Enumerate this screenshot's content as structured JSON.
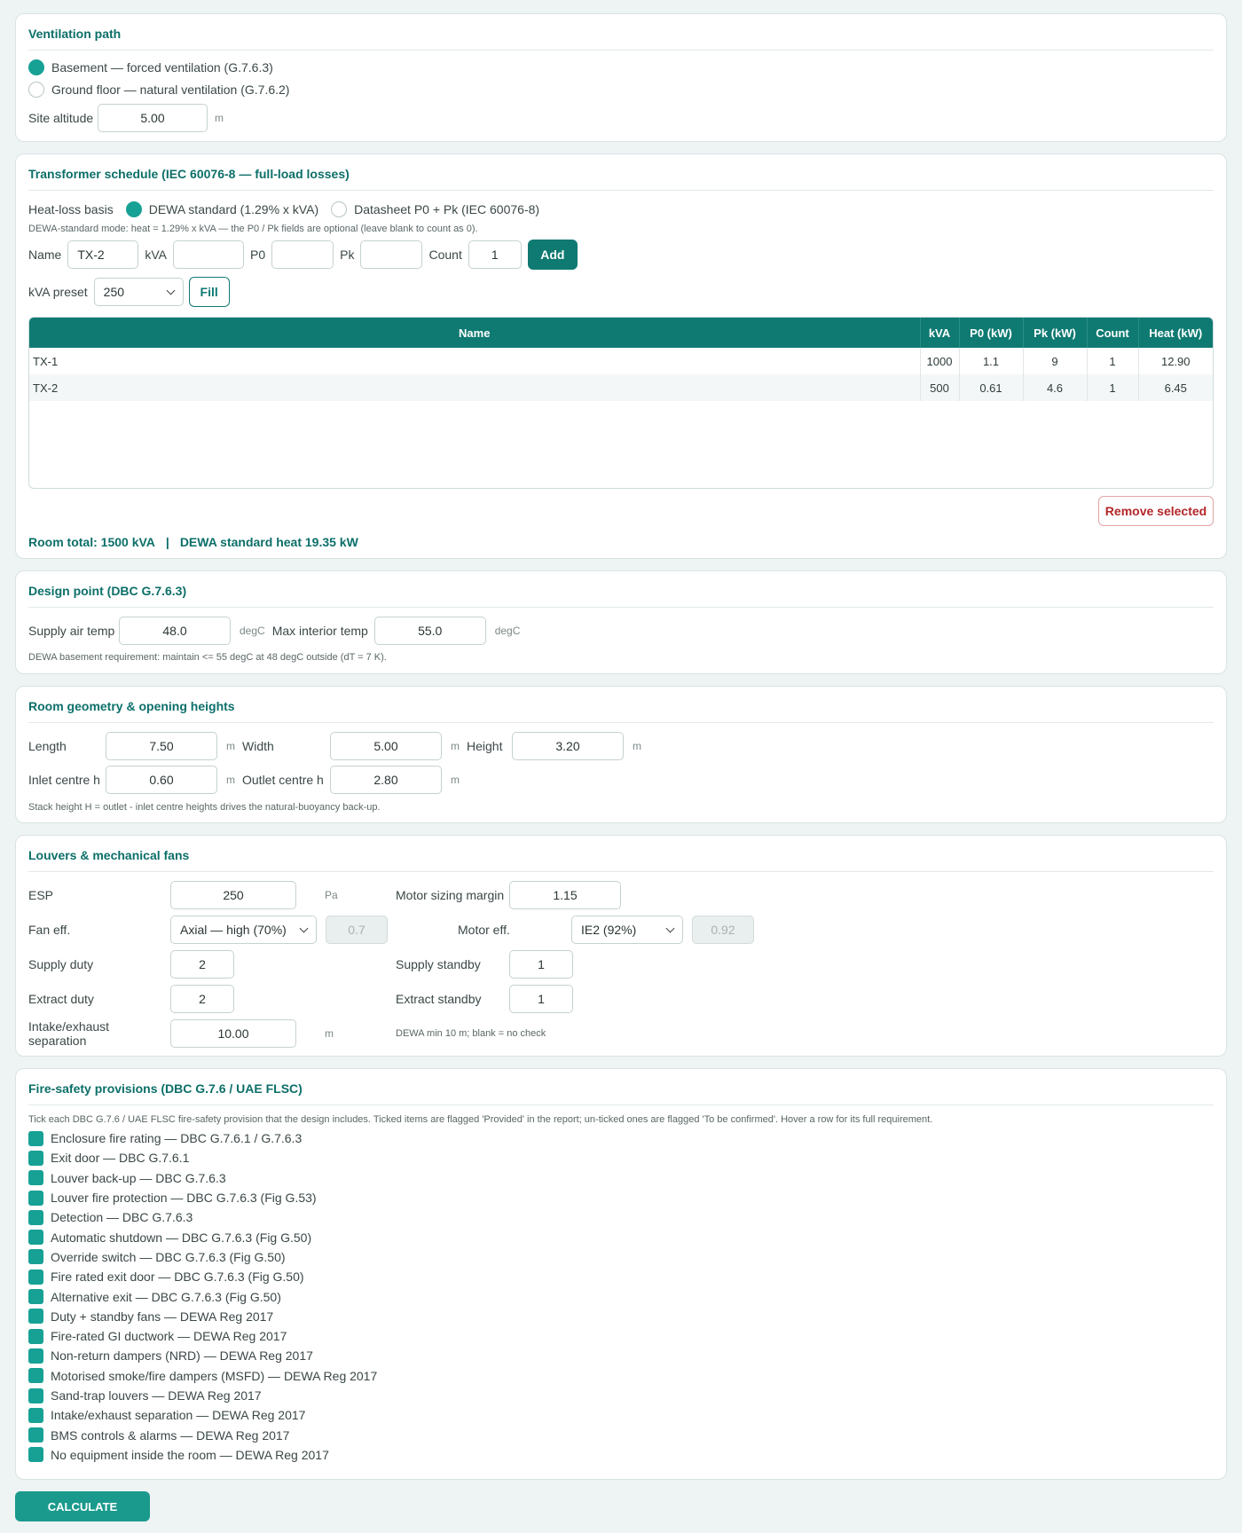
{
  "ventilation": {
    "title": "Ventilation path",
    "options": [
      {
        "label": "Basement — forced ventilation (G.7.6.3)",
        "selected": true
      },
      {
        "label": "Ground floor — natural ventilation (G.7.6.2)",
        "selected": false
      }
    ],
    "altitude_label": "Site altitude",
    "altitude_value": "5.00",
    "altitude_unit": "m"
  },
  "transformer": {
    "title": "Transformer schedule (IEC 60076-8 — full-load losses)",
    "basis_label": "Heat-loss basis",
    "basis_options": [
      {
        "label": "DEWA standard (1.29% x kVA)",
        "selected": true
      },
      {
        "label": "Datasheet P0 + Pk (IEC 60076-8)",
        "selected": false
      }
    ],
    "mode_note": "DEWA-standard mode: heat = 1.29% x kVA — the P0 / Pk fields are optional (leave blank to count as 0).",
    "name_label": "Name",
    "name_value": "TX-2",
    "kva_label": "kVA",
    "kva_value": "",
    "p0_label": "P0",
    "p0_value": "",
    "pk_label": "Pk",
    "pk_value": "",
    "count_label": "Count",
    "count_value": "1",
    "add_label": "Add",
    "preset_label": "kVA preset",
    "preset_value": "250",
    "fill_label": "Fill",
    "columns": [
      "Name",
      "kVA",
      "P0 (kW)",
      "Pk (kW)",
      "Count",
      "Heat (kW)"
    ],
    "rows": [
      [
        "TX-1",
        "1000",
        "1.1",
        "9",
        "1",
        "12.90"
      ],
      [
        "TX-2",
        "500",
        "0.61",
        "4.6",
        "1",
        "6.45"
      ]
    ],
    "remove_label": "Remove selected",
    "total_label": "Room total: 1500 kVA",
    "separator": "|",
    "heat_label": "DEWA standard heat 19.35 kW"
  },
  "design": {
    "title": "Design point (DBC G.7.6.3)",
    "supply_label": "Supply air temp",
    "supply_value": "48.0",
    "supply_unit": "degC",
    "max_label": "Max interior temp",
    "max_value": "55.0",
    "max_unit": "degC",
    "note": "DEWA basement requirement: maintain <= 55 degC at 48 degC outside (dT = 7 K)."
  },
  "geometry": {
    "title": "Room geometry & opening heights",
    "length_label": "Length",
    "length_value": "7.50",
    "length_unit": "m",
    "width_label": "Width",
    "width_value": "5.00",
    "width_unit": "m",
    "height_label": "Height",
    "height_value": "3.20",
    "height_unit": "m",
    "inlet_label": "Inlet centre h",
    "inlet_value": "0.60",
    "inlet_unit": "m",
    "outlet_label": "Outlet centre h",
    "outlet_value": "2.80",
    "outlet_unit": "m",
    "note": "Stack height H = outlet - inlet centre heights drives the natural-buoyancy back-up."
  },
  "louvers": {
    "title": "Louvers & mechanical fans",
    "esp_label": "ESP",
    "esp_value": "250",
    "esp_unit": "Pa",
    "margin_label": "Motor sizing margin",
    "margin_value": "1.15",
    "fan_label": "Fan eff.",
    "fan_select": "Axial — high (70%)",
    "fan_value": "0.7",
    "motor_label": "Motor eff.",
    "motor_select": "IE2 (92%)",
    "motor_value": "0.92",
    "supply_duty_label": "Supply duty",
    "supply_duty_value": "2",
    "supply_standby_label": "Supply standby",
    "supply_standby_value": "1",
    "extract_duty_label": "Extract duty",
    "extract_duty_value": "2",
    "extract_standby_label": "Extract standby",
    "extract_standby_value": "1",
    "separation_label": "Intake/exhaust separation",
    "separation_value": "10.00",
    "separation_unit": "m",
    "separation_note": "DEWA min 10 m; blank = no check"
  },
  "fire": {
    "title": "Fire-safety provisions (DBC G.7.6 / UAE FLSC)",
    "note": "Tick each DBC G.7.6 / UAE FLSC fire-safety provision that the design includes. Ticked items are flagged 'Provided' in the report; un-ticked ones are flagged 'To be confirmed'. Hover a row for its full requirement.",
    "items": [
      "Enclosure fire rating — DBC G.7.6.1 / G.7.6.3",
      "Exit door — DBC G.7.6.1",
      "Louver back-up — DBC G.7.6.3",
      "Louver fire protection — DBC G.7.6.3 (Fig G.53)",
      "Detection — DBC G.7.6.3",
      "Automatic shutdown — DBC G.7.6.3 (Fig G.50)",
      "Override switch — DBC G.7.6.3 (Fig G.50)",
      "Fire rated exit door — DBC G.7.6.3 (Fig G.50)",
      "Alternative exit — DBC G.7.6.3 (Fig G.50)",
      "Duty + standby fans — DEWA Reg 2017",
      "Fire-rated GI ductwork — DEWA Reg 2017",
      "Non-return dampers (NRD) — DEWA Reg 2017",
      "Motorised smoke/fire dampers (MSFD) — DEWA Reg 2017",
      "Sand-trap louvers — DEWA Reg 2017",
      "Intake/exhaust separation — DEWA Reg 2017",
      "BMS controls & alarms — DEWA Reg 2017",
      "No equipment inside the room — DEWA Reg 2017"
    ]
  },
  "calculate_label": "CALCULATE",
  "colors": {
    "accent": "#0f7a72",
    "radio_on": "#17a195",
    "danger": "#b3262a",
    "background": "#eef3f3"
  }
}
